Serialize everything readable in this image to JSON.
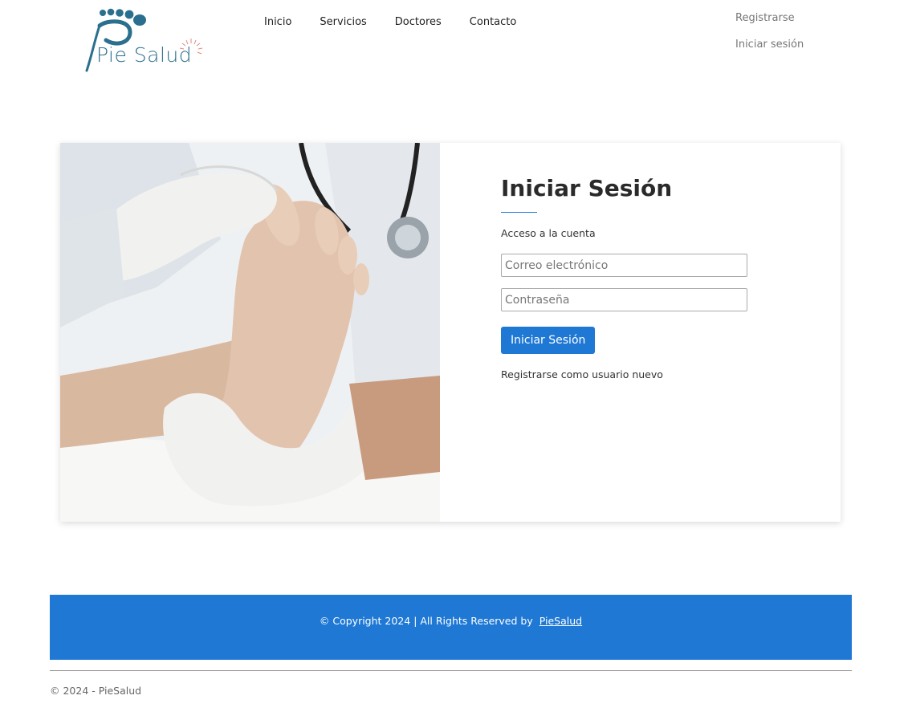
{
  "brand": {
    "name": "Pie Salud",
    "primary_color": "#1e78d4",
    "logo_color": "#2b6f8e"
  },
  "nav": {
    "items": [
      "Inicio",
      "Servicios",
      "Doctores",
      "Contacto"
    ]
  },
  "auth": {
    "register": "Registrarse",
    "login": "Iniciar sesión"
  },
  "login_card": {
    "image": "podiatrist-examining-foot",
    "title": "Iniciar Sesión",
    "subtitle": "Acceso a la cuenta",
    "email_placeholder": "Correo electrónico",
    "password_placeholder": "Contraseña",
    "submit_label": "Iniciar Sesión",
    "register_link": "Registrarse como usuario nuevo"
  },
  "footer": {
    "copyright": "© Copyright 2024 | All Rights Reserved by",
    "brand_link": "PieSalud",
    "bottom_note": "© 2024 - PieSalud"
  }
}
